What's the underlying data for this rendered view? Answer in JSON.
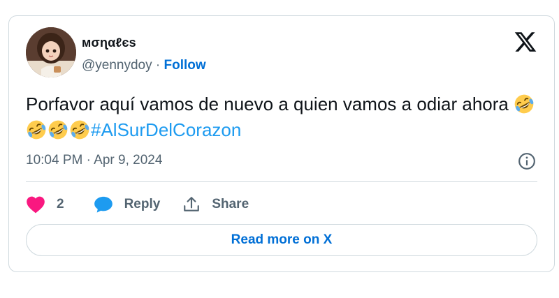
{
  "author": {
    "display_name": "мσɳαℓєѕ",
    "handle": "@yennydoy",
    "separator": " · ",
    "follow_label": "Follow"
  },
  "tweet": {
    "text_main": "Porfavor aquí vamos de nuevo a quien vamos a odiar ahora ",
    "emoji_name": "rolling-on-the-floor-laughing",
    "emoji_count": 4,
    "hashtag": "#AlSurDelCorazon",
    "timestamp": "10:04 PM · Apr 9, 2024"
  },
  "actions": {
    "like_count": "2",
    "reply_label": "Reply",
    "share_label": "Share"
  },
  "read_more_label": "Read more on X",
  "icons": {
    "brand": "x-logo-icon",
    "info": "info-icon",
    "like": "heart-icon",
    "reply": "reply-bubble-icon",
    "share": "share-icon"
  },
  "colors": {
    "link_blue": "#006fd6",
    "hashtag_blue": "#1d9bf0",
    "heart_pink": "#f91880",
    "reply_blue": "#1d9bf0",
    "secondary_text": "#536471",
    "border": "#cfd9de"
  }
}
